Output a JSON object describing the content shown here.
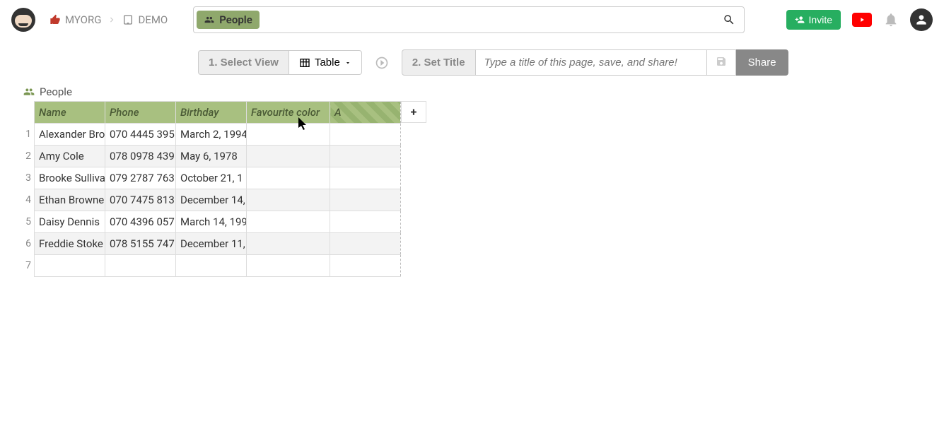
{
  "breadcrumb": {
    "org": "MYORG",
    "page": "DEMO"
  },
  "search": {
    "tag_label": "People"
  },
  "topbar": {
    "invite_label": "Invite"
  },
  "toolbar": {
    "step1_label": "1. Select View",
    "table_label": "Table",
    "step2_label": "2. Set Title",
    "title_placeholder": "Type a title of this page, save, and share!",
    "share_label": "Share"
  },
  "sheet": {
    "title": "People",
    "columns": [
      "Name",
      "Phone",
      "Birthday",
      "Favourite color",
      "A"
    ],
    "rows": [
      {
        "name": "Alexander Bro",
        "phone": "070 4445 395",
        "birthday": "March 2, 1994",
        "fav": "",
        "a": ""
      },
      {
        "name": "Amy Cole",
        "phone": "078 0978 439",
        "birthday": "May 6, 1978",
        "fav": "",
        "a": ""
      },
      {
        "name": "Brooke Sulliva",
        "phone": "079 2787 763",
        "birthday": "October 21, 1",
        "fav": "",
        "a": ""
      },
      {
        "name": "Ethan Browne",
        "phone": "070 7475 813",
        "birthday": "December 14,",
        "fav": "",
        "a": ""
      },
      {
        "name": "Daisy Dennis",
        "phone": "070 4396 057",
        "birthday": "March 14, 199",
        "fav": "",
        "a": ""
      },
      {
        "name": "Freddie Stoke",
        "phone": "078 5155 747",
        "birthday": "December 11,",
        "fav": "",
        "a": ""
      },
      {
        "name": "",
        "phone": "",
        "birthday": "",
        "fav": "",
        "a": ""
      }
    ]
  }
}
